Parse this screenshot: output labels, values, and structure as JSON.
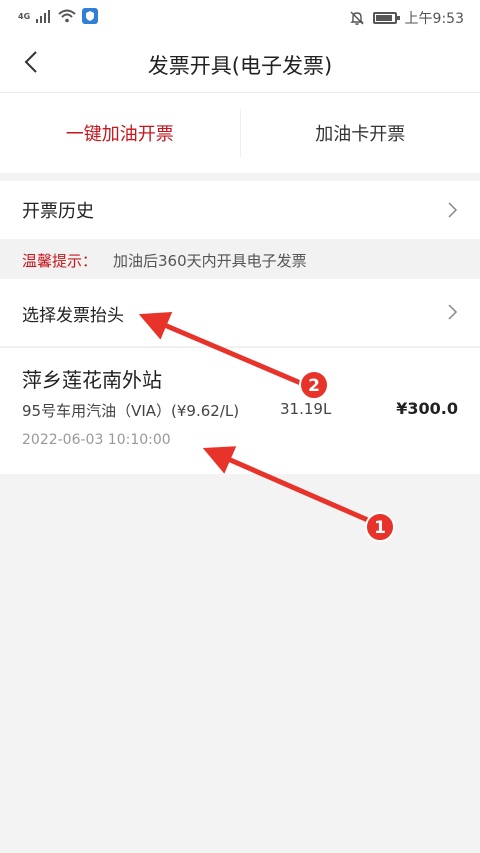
{
  "status_bar": {
    "network": "4G",
    "time": "上午9:53"
  },
  "header": {
    "title": "发票开具(电子发票)"
  },
  "tabs": [
    {
      "label": "一键加油开票",
      "active": true
    },
    {
      "label": "加油卡开票",
      "active": false
    }
  ],
  "history": {
    "label": "开票历史"
  },
  "notice": {
    "prefix": "温馨提示：",
    "text": "加油后360天内开具电子发票"
  },
  "invoice_header": {
    "label": "选择发票抬头"
  },
  "order": {
    "station": "萍乡莲花南外站",
    "fuel": "95号车用汽油（VIA）(¥9.62/L)",
    "volume": "31.19L",
    "amount": "¥300.0",
    "time": "2022-06-03 10:10:00"
  },
  "annotations": [
    {
      "label": "1"
    },
    {
      "label": "2"
    }
  ],
  "colors": {
    "accent": "#c7161e",
    "annotation": "#e8332a"
  }
}
